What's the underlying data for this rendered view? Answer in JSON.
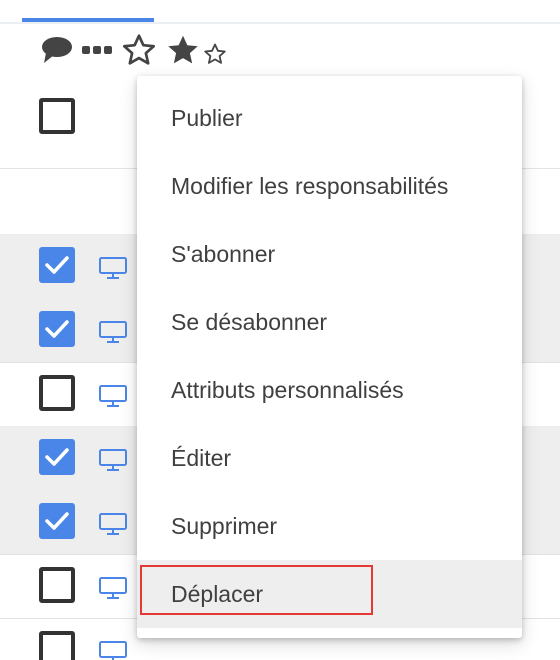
{
  "toolbar": {
    "icons": [
      "comment-icon",
      "more-icon",
      "star-outline-icon",
      "star-filled-icon"
    ]
  },
  "list": {
    "rows": [
      {
        "checked": true,
        "type_icon": "monitor-icon"
      },
      {
        "checked": true,
        "type_icon": "monitor-icon"
      },
      {
        "checked": false,
        "type_icon": "monitor-icon"
      },
      {
        "checked": true,
        "type_icon": "monitor-icon"
      },
      {
        "checked": true,
        "type_icon": "monitor-icon"
      },
      {
        "checked": false,
        "type_icon": "monitor-icon"
      },
      {
        "checked": false,
        "type_icon": "monitor-icon"
      }
    ]
  },
  "context_menu": {
    "items": [
      {
        "label": "Publier"
      },
      {
        "label": "Modifier les responsabilités"
      },
      {
        "label": "S'abonner"
      },
      {
        "label": "Se désabonner"
      },
      {
        "label": "Attributs personnalisés"
      },
      {
        "label": "Éditer"
      },
      {
        "label": "Supprimer"
      },
      {
        "label": "Déplacer"
      }
    ],
    "hovered_index": 7
  },
  "colors": {
    "accent": "#4a86e8",
    "highlight": "#e53935",
    "menu_text": "#404040",
    "selected_row": "#eeeeee"
  }
}
